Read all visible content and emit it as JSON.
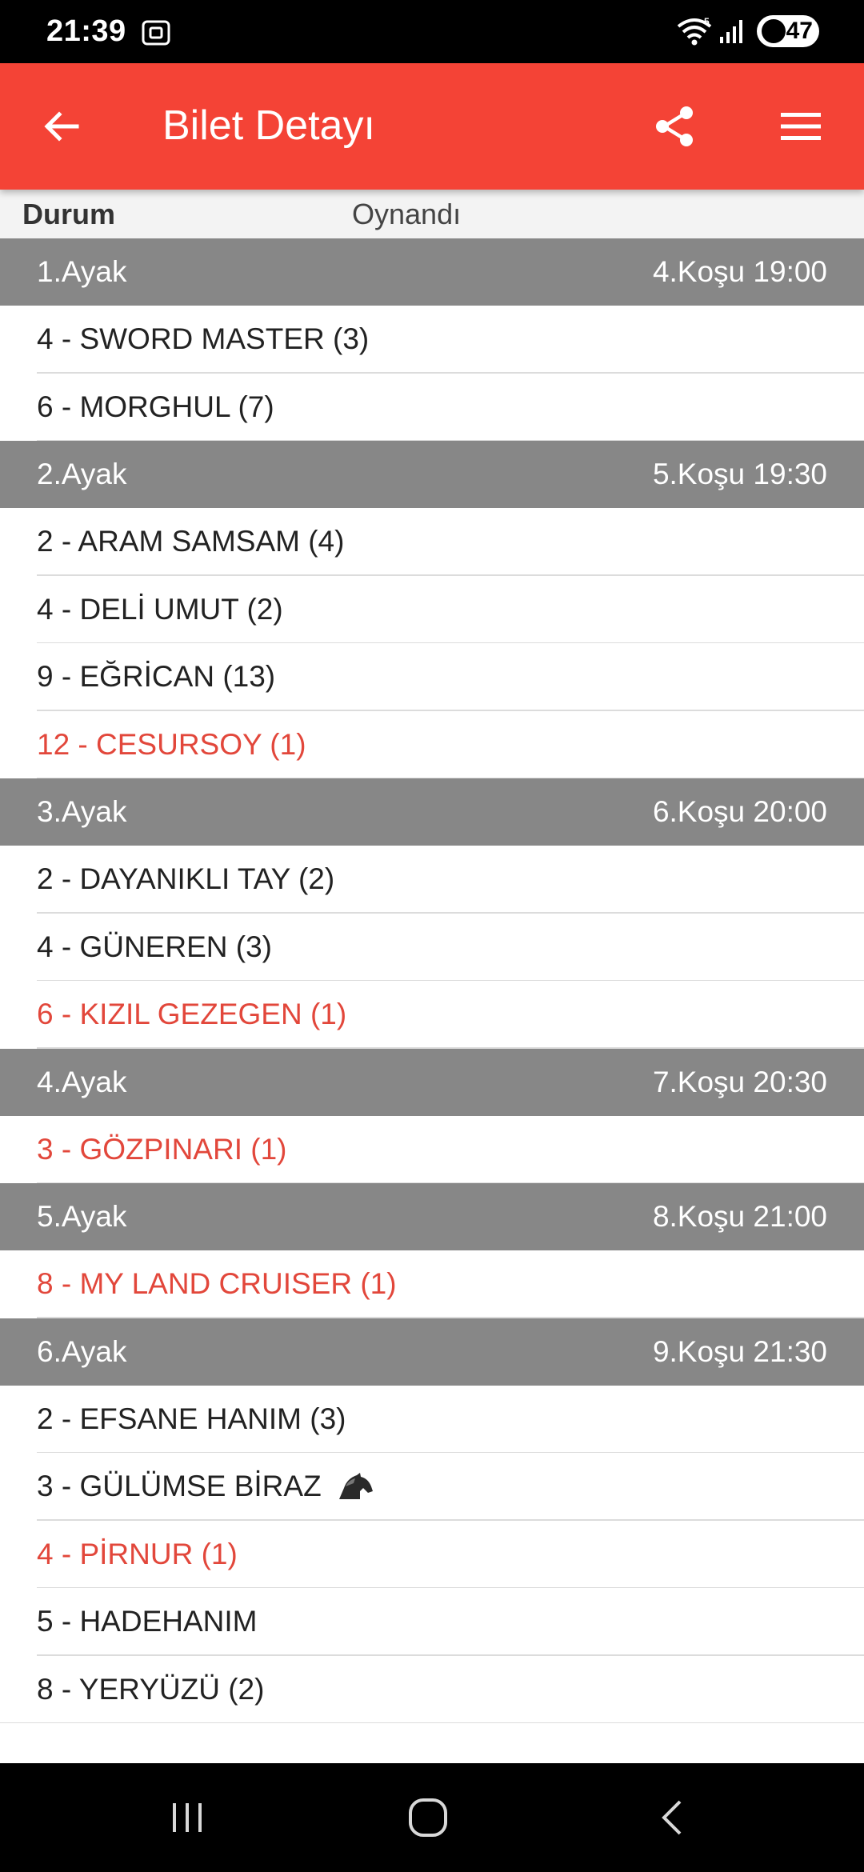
{
  "status_bar": {
    "time": "21:39",
    "battery": "47",
    "icons": [
      "screenshot-icon",
      "wifi-icon",
      "signal-icon",
      "battery-icon"
    ]
  },
  "app_bar": {
    "title": "Bilet Detayı",
    "icons": [
      "back-arrow-icon",
      "share-icon",
      "hamburger-menu-icon"
    ],
    "color": "#f44336"
  },
  "status_row": {
    "label": "Durum",
    "value": "Oynandı"
  },
  "legs": [
    {
      "leg": "1.Ayak",
      "race": "4.Koşu 19:00",
      "runners": [
        {
          "text": "4 - SWORD MASTER (3)",
          "winner": false
        },
        {
          "text": "6 - MORGHUL (7)",
          "winner": false
        }
      ]
    },
    {
      "leg": "2.Ayak",
      "race": "5.Koşu 19:30",
      "runners": [
        {
          "text": "2 - ARAM SAMSAM (4)",
          "winner": false
        },
        {
          "text": "4 - DELİ UMUT (2)",
          "winner": false
        },
        {
          "text": "9 - EĞRİCAN (13)",
          "winner": false
        },
        {
          "text": "12 - CESURSOY (1)",
          "winner": true
        }
      ]
    },
    {
      "leg": "3.Ayak",
      "race": "6.Koşu 20:00",
      "runners": [
        {
          "text": "2 - DAYANIKLI TAY (2)",
          "winner": false
        },
        {
          "text": "4 - GÜNEREN (3)",
          "winner": false
        },
        {
          "text": "6 - KIZIL GEZEGEN (1)",
          "winner": true
        }
      ]
    },
    {
      "leg": "4.Ayak",
      "race": "7.Koşu 20:30",
      "runners": [
        {
          "text": "3 - GÖZPINARI (1)",
          "winner": true
        }
      ]
    },
    {
      "leg": "5.Ayak",
      "race": "8.Koşu 21:00",
      "runners": [
        {
          "text": "8 - MY LAND CRUISER (1)",
          "winner": true
        }
      ]
    },
    {
      "leg": "6.Ayak",
      "race": "9.Koşu 21:30",
      "runners": [
        {
          "text": "2 - EFSANE HANIM (3)",
          "winner": false
        },
        {
          "text": "3 - GÜLÜMSE BİRAZ",
          "winner": false,
          "icon": "horse-head-icon"
        },
        {
          "text": "4 - PİRNUR (1)",
          "winner": true
        },
        {
          "text": "5 - HADEHANIM",
          "winner": false
        },
        {
          "text": "8 - YERYÜZÜ (2)",
          "winner": false
        }
      ]
    }
  ],
  "colors": {
    "winner_text": "#e2473b",
    "leg_header_bg": "#878787"
  },
  "nav_bar": {
    "icons": [
      "recent-apps-icon",
      "home-icon",
      "back-nav-icon"
    ]
  }
}
